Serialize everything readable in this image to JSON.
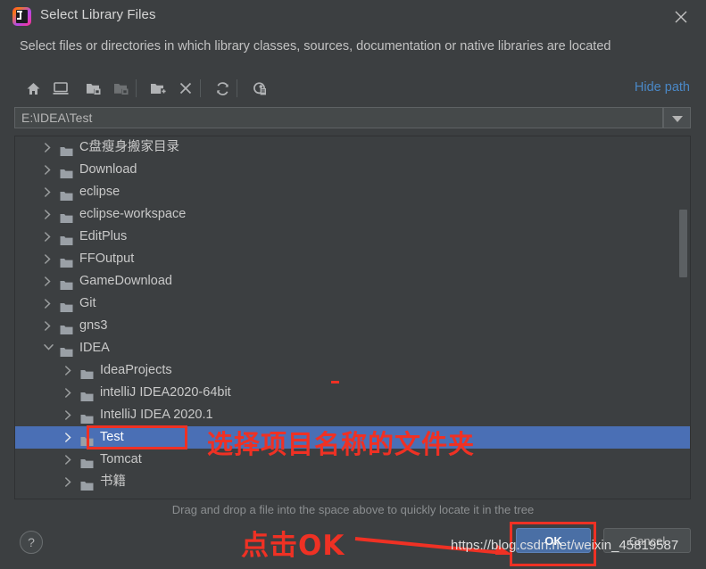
{
  "window": {
    "title": "Select Library Files",
    "subtitle": "Select files or directories in which library classes, sources, documentation or native libraries are located",
    "close_icon": "close-icon",
    "app_icon": "intellij-idea-logo"
  },
  "toolbar": {
    "buttons": [
      {
        "name": "home-icon",
        "tooltip": "Home"
      },
      {
        "name": "desktop-icon",
        "tooltip": "Desktop"
      },
      {
        "name": "expand-folder-icon",
        "tooltip": "Expand"
      },
      {
        "name": "collapse-folder-icon",
        "tooltip": "Collapse"
      },
      {
        "name": "new-folder-icon",
        "tooltip": "New Folder"
      },
      {
        "name": "delete-icon",
        "tooltip": "Delete"
      },
      {
        "name": "refresh-icon",
        "tooltip": "Refresh"
      },
      {
        "name": "show-hidden-files-icon",
        "tooltip": "Show Hidden Files"
      }
    ],
    "hide_path_label": "Hide path"
  },
  "path_field": {
    "value": "E:\\IDEA\\Test",
    "placeholder": "",
    "dropdown_icon": "chevron-down-icon"
  },
  "tree": {
    "items": [
      {
        "label": "C盘瘦身搬家目录",
        "depth": 1,
        "expanded": false,
        "selected": false
      },
      {
        "label": "Download",
        "depth": 1,
        "expanded": false,
        "selected": false
      },
      {
        "label": "eclipse",
        "depth": 1,
        "expanded": false,
        "selected": false
      },
      {
        "label": "eclipse-workspace",
        "depth": 1,
        "expanded": false,
        "selected": false
      },
      {
        "label": "EditPlus",
        "depth": 1,
        "expanded": false,
        "selected": false
      },
      {
        "label": "FFOutput",
        "depth": 1,
        "expanded": false,
        "selected": false
      },
      {
        "label": "GameDownload",
        "depth": 1,
        "expanded": false,
        "selected": false
      },
      {
        "label": "Git",
        "depth": 1,
        "expanded": false,
        "selected": false
      },
      {
        "label": "gns3",
        "depth": 1,
        "expanded": false,
        "selected": false
      },
      {
        "label": "IDEA",
        "depth": 1,
        "expanded": true,
        "selected": false
      },
      {
        "label": "IdeaProjects",
        "depth": 2,
        "expanded": false,
        "selected": false
      },
      {
        "label": "intelliJ IDEA2020-64bit",
        "depth": 2,
        "expanded": false,
        "selected": false
      },
      {
        "label": "IntelliJ IDEA 2020.1",
        "depth": 2,
        "expanded": false,
        "selected": false
      },
      {
        "label": "Test",
        "depth": 2,
        "expanded": false,
        "selected": true
      },
      {
        "label": "Tomcat",
        "depth": 2,
        "expanded": false,
        "selected": false
      },
      {
        "label": "书籍",
        "depth": 2,
        "expanded": false,
        "selected": false
      }
    ],
    "scrollbar": "vertical-scrollbar"
  },
  "footer": {
    "hint": "Drag and drop a file into the space above to quickly locate it in the tree",
    "help_label": "?",
    "ok_label": "OK",
    "cancel_label": "Cancel"
  },
  "annotations": {
    "tree_note": "选择项目名称的文件夹",
    "ok_note": "点击OK",
    "watermark": "https://blog.csdn.net/weixin_45819587",
    "highlight_color": "#ef3124"
  }
}
